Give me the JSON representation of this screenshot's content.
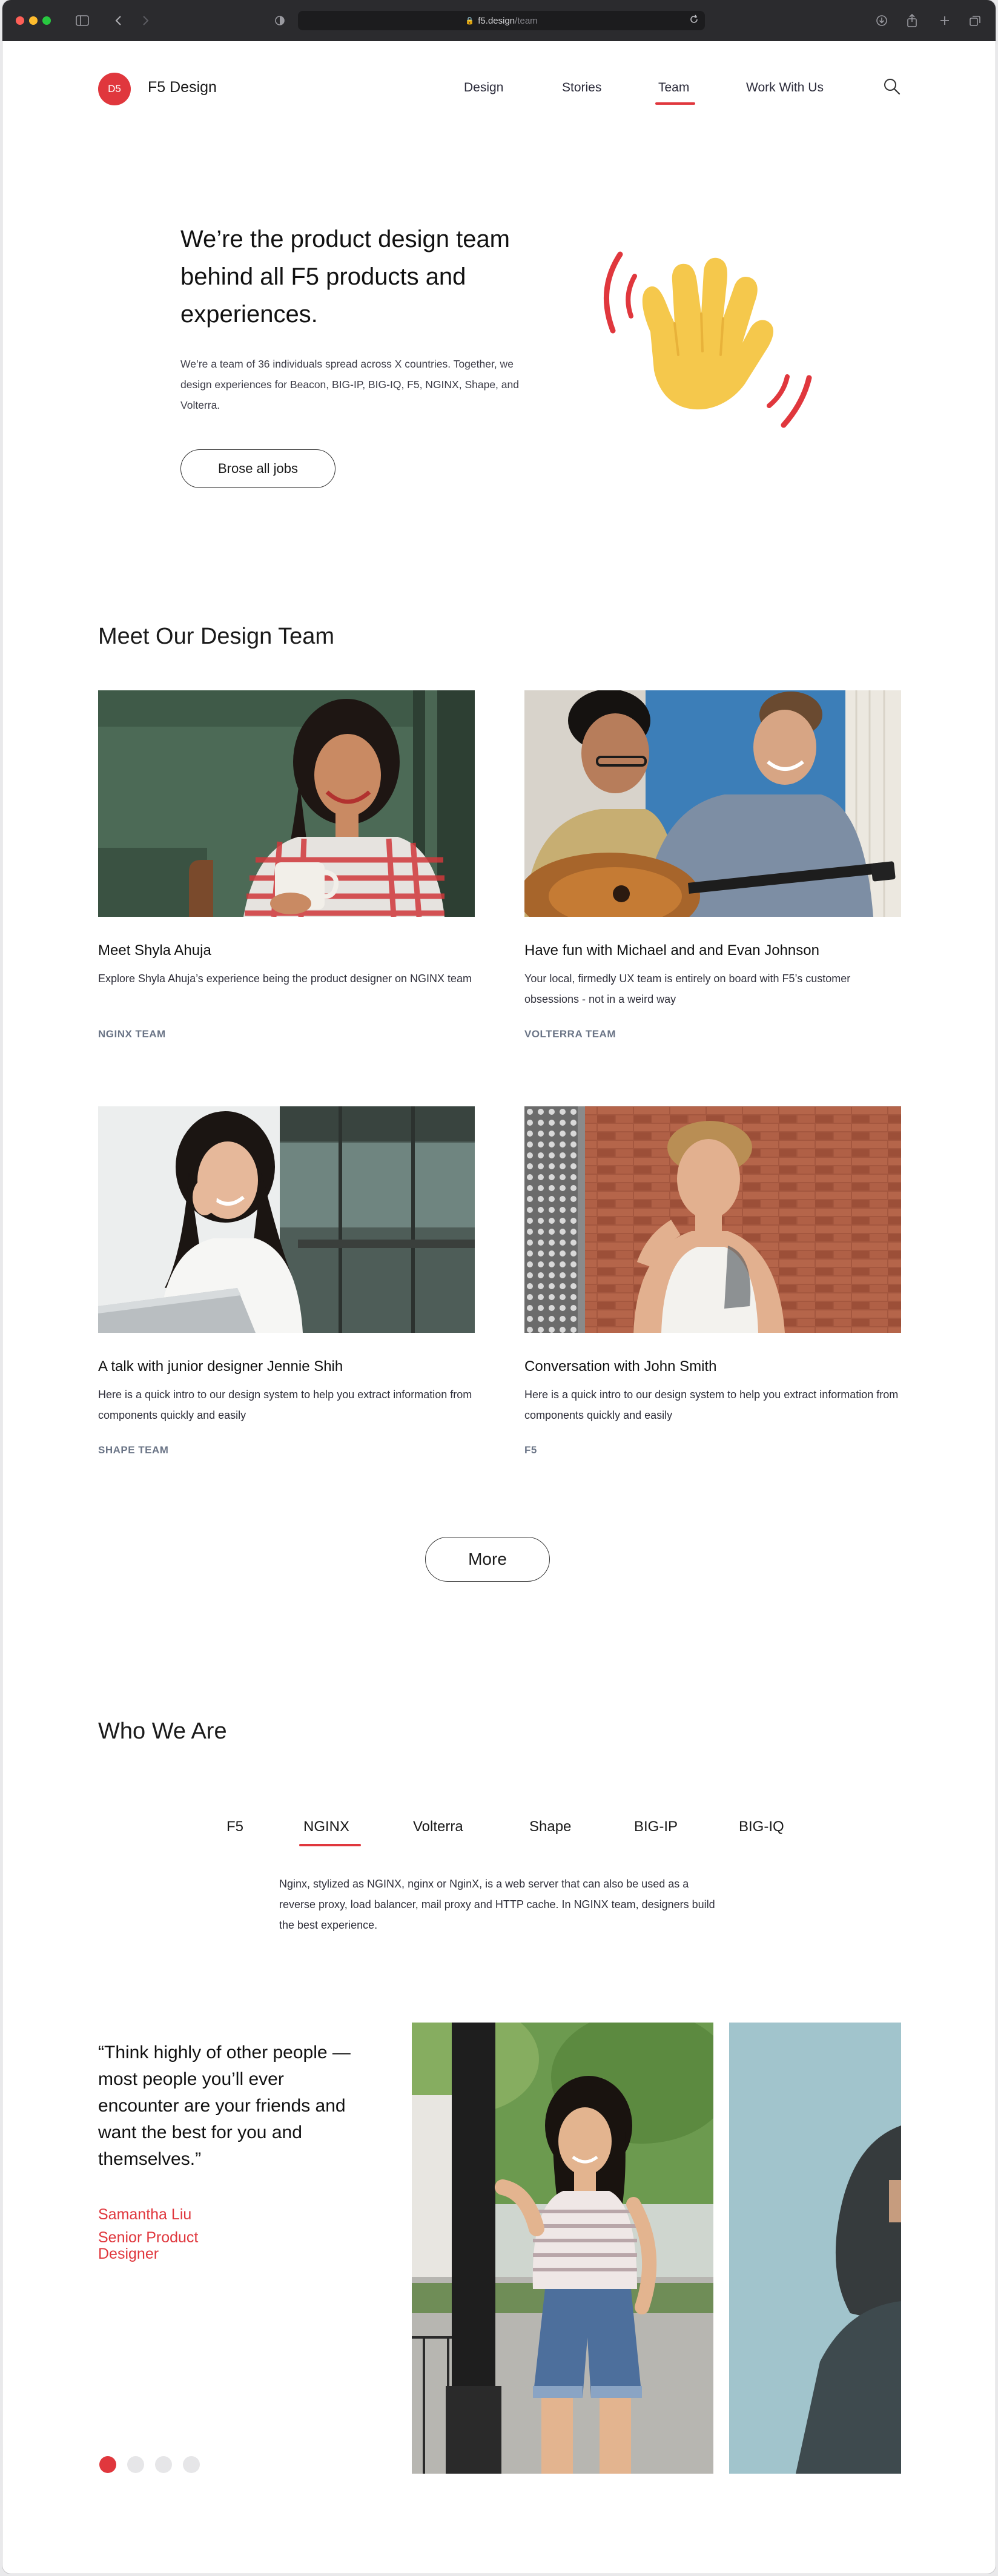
{
  "browser": {
    "url_host": "f5.design",
    "url_path": "/team",
    "traffic_lights": [
      "#fe5f57",
      "#febc2e",
      "#28c840"
    ]
  },
  "header": {
    "logo_initials": "D5",
    "brand_name": "F5 Design",
    "nav": [
      {
        "label": "Design",
        "active": false
      },
      {
        "label": "Stories",
        "active": false
      },
      {
        "label": "Team",
        "active": true
      },
      {
        "label": "Work With Us",
        "active": false
      }
    ],
    "search_icon": "search-icon"
  },
  "hero": {
    "title": "We’re the product design team behind all F5 products and experiences.",
    "body": "We’re a team of 36 individuals spread across X countries. Together, we design experiences for Beacon, BIG-IP, BIG-IQ, F5, NGINX, Shape, and Volterra.",
    "cta_label": "Brose all jobs",
    "illustration": "waving-hand-icon"
  },
  "team_section": {
    "title": "Meet Our Design Team",
    "cards": [
      {
        "title": "Meet Shyla Ahuja",
        "description": "Explore Shyla Ahuja’s experience being the product designer on NGINX team",
        "tag": "NGINX TEAM"
      },
      {
        "title": "Have fun with Michael and and Evan Johnson",
        "description": "Your local, firmedly UX team is entirely on board with F5’s customer obsessions - not in a weird way",
        "tag": "VOLTERRA TEAM"
      },
      {
        "title": "A talk with junior designer Jennie Shih",
        "description": "Here is a quick intro to our design system to help you extract information from components quickly and easily",
        "tag": "SHAPE TEAM"
      },
      {
        "title": "Conversation with John Smith",
        "description": "Here is a quick intro to our design system to help you extract information from components quickly and easily",
        "tag": "F5"
      }
    ],
    "more_label": "More"
  },
  "who_section": {
    "title": "Who We Are",
    "tabs": [
      {
        "label": "F5",
        "active": false
      },
      {
        "label": "NGINX",
        "active": true
      },
      {
        "label": "Volterra",
        "active": false
      },
      {
        "label": "Shape",
        "active": false
      },
      {
        "label": "BIG-IP",
        "active": false
      },
      {
        "label": "BIG-IQ",
        "active": false
      }
    ],
    "tab_description": "Nginx, stylized as NGINX, nginx or NginX, is a web server that can also be used as a reverse proxy, load balancer, mail proxy and HTTP cache. In NGINX team, designers build the best experience."
  },
  "testimonial": {
    "quote": "“Think highly of other people — most people you’ll ever encounter are your friends and want the best for you and themselves.”",
    "name": "Samantha Liu",
    "role": "Senior Product Designer",
    "pager": {
      "total": 4,
      "active_index": 0
    }
  },
  "colors": {
    "accent": "#e0373d",
    "tag_gray": "#6a7486",
    "chrome_bg": "#2b2b2e"
  }
}
